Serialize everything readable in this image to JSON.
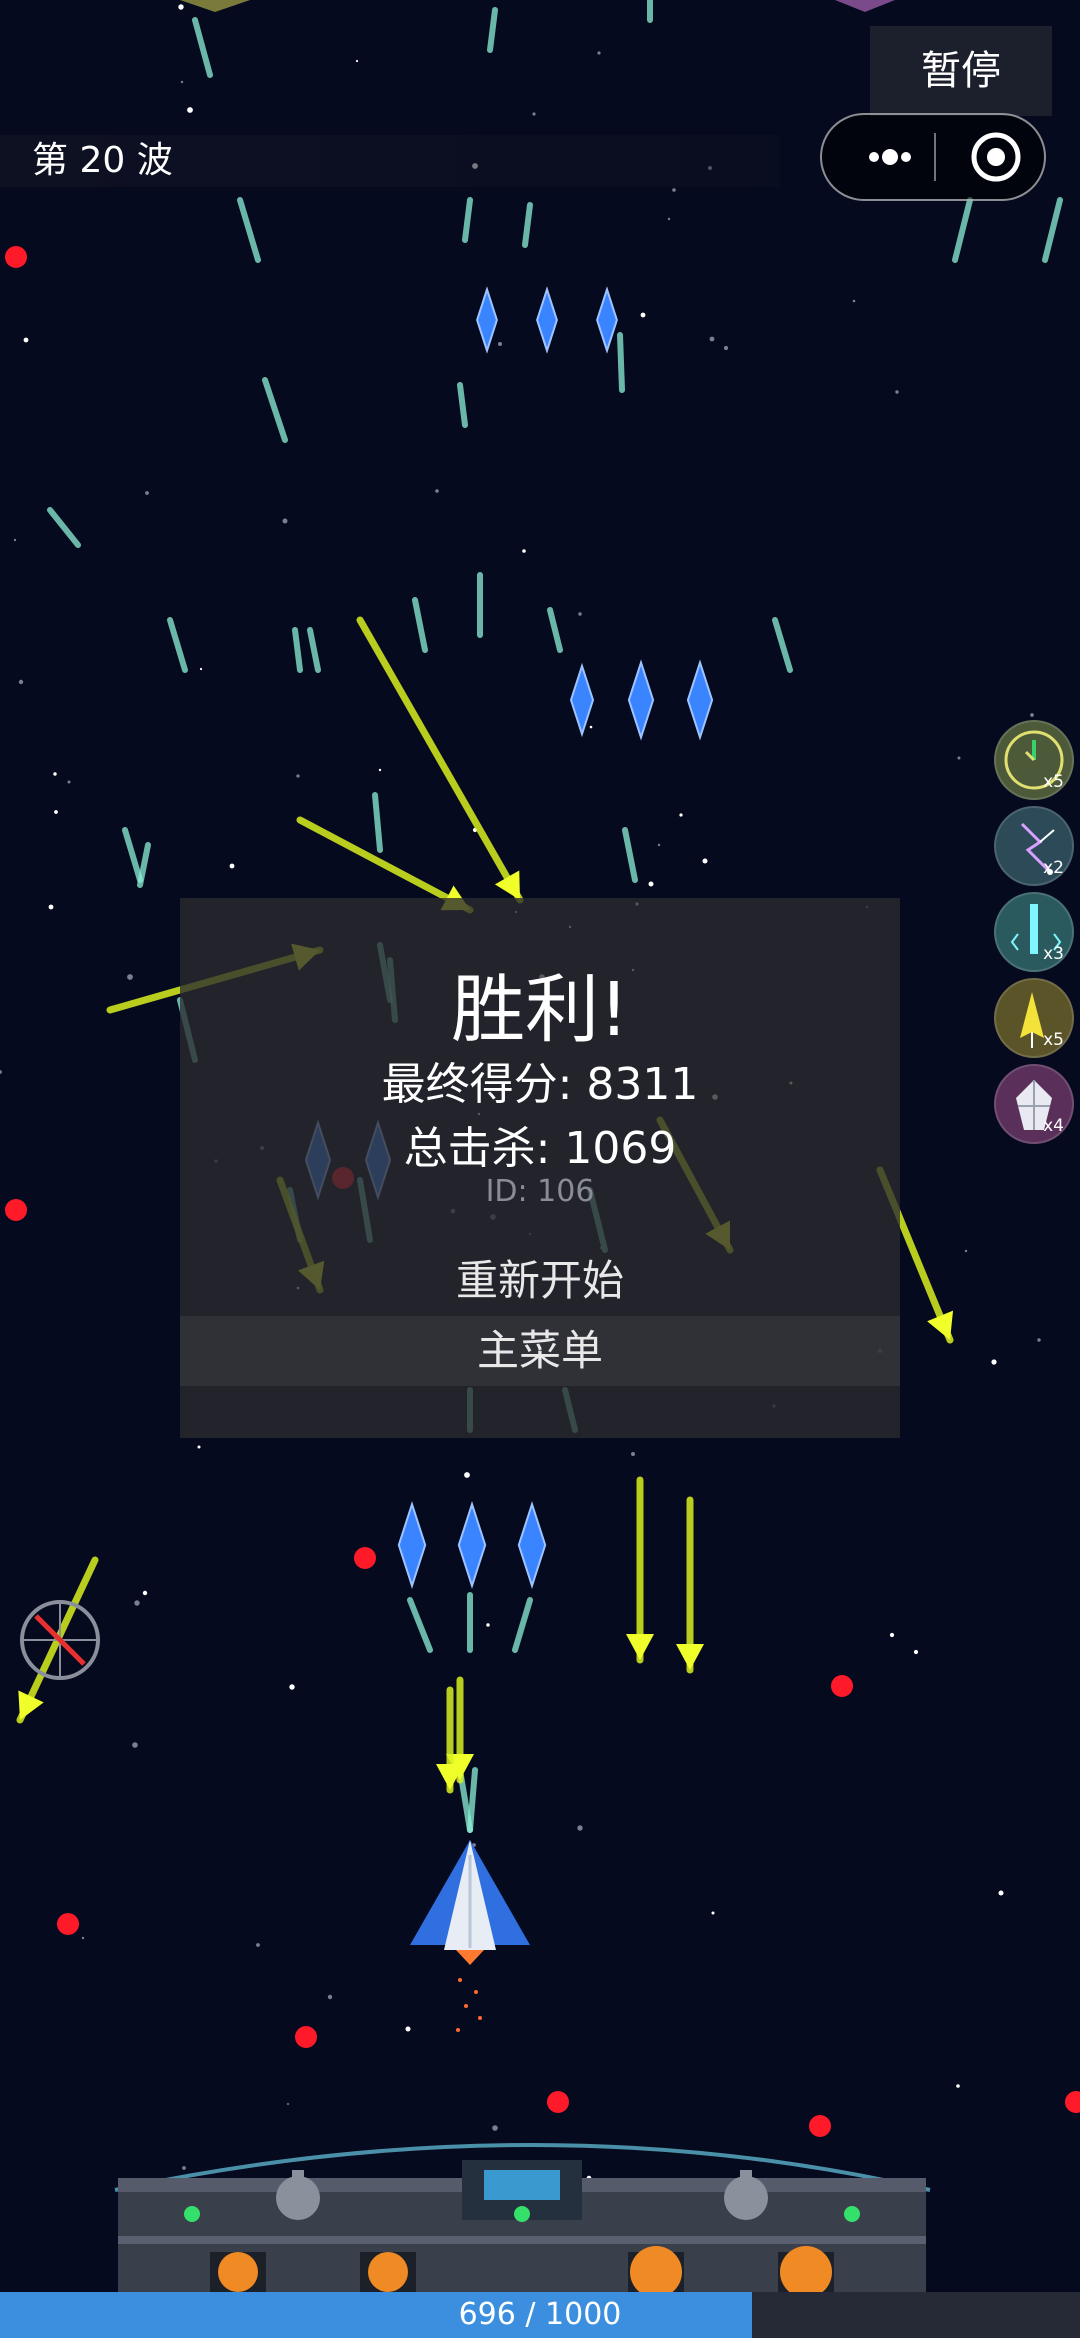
{
  "hud": {
    "wave_label": "第 20 波",
    "pause_label": "暂停"
  },
  "powerups": [
    {
      "icon": "clock-icon",
      "count": "x5",
      "color": "#4c5a3a"
    },
    {
      "icon": "lightning-icon",
      "count": "x2",
      "color": "#2c4a58"
    },
    {
      "icon": "laser-icon",
      "count": "x3",
      "color": "#2b5a5e"
    },
    {
      "icon": "missile-icon",
      "count": "x5",
      "color": "#5a5428"
    },
    {
      "icon": "shield-icon",
      "count": "x4",
      "color": "#5a2f5a"
    }
  ],
  "result": {
    "title": "胜利!",
    "score": "最终得分: 8311",
    "kills": "总击杀: 1069",
    "id": "ID: 106",
    "restart": "重新开始",
    "main_menu": "主菜单"
  },
  "health": {
    "text": "696 / 1000",
    "value": 696,
    "max": 1000,
    "color": "#3b8fde"
  }
}
